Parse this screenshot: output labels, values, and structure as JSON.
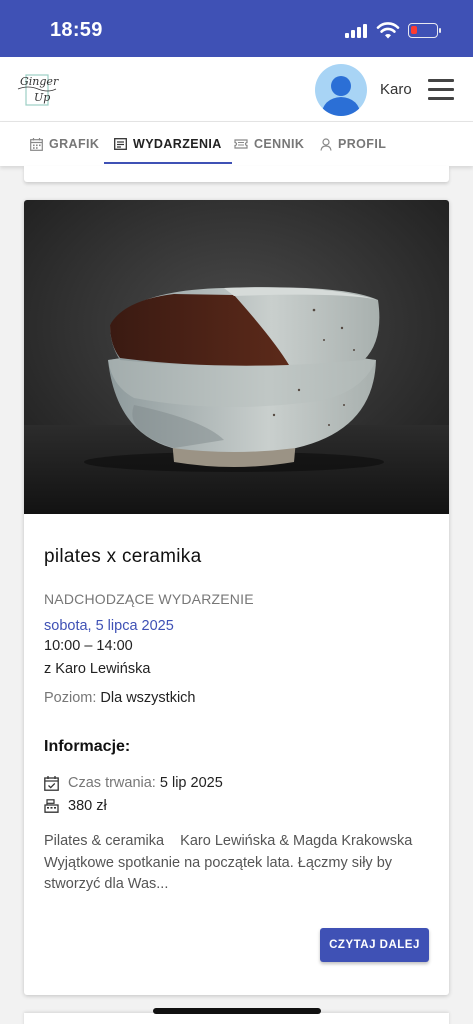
{
  "status_bar": {
    "time": "18:59"
  },
  "header": {
    "logo_line1": "Ginger",
    "logo_line2": "Up",
    "username": "Karo"
  },
  "tabs": [
    {
      "label": "GRAFIK",
      "icon": "calendar-icon",
      "active": false
    },
    {
      "label": "WYDARZENIA",
      "icon": "event-card-icon",
      "active": true
    },
    {
      "label": "CENNIK",
      "icon": "ticket-icon",
      "active": false
    },
    {
      "label": "PROFIL",
      "icon": "person-icon",
      "active": false
    }
  ],
  "event": {
    "title": "pilates x ceramika",
    "status": "NADCHODZĄCE WYDARZENIE",
    "date": "sobota, 5 lipca 2025",
    "time": "10:00 – 14:00",
    "host": "z Karo Lewińska",
    "level_label": "Poziom:",
    "level_value": "Dla wszystkich",
    "info_heading": "Informacje:",
    "duration_label": "Czas trwania:",
    "duration_value": "5 lip 2025",
    "price": "380 zł",
    "description": "Pilates & ceramika    Karo Lewińska & Magda Krakowska Wyjątkowe spotkanie na początek lata. Łączmy siły by stworzyć dla Was...",
    "read_more_label": "CZYTAJ DALEJ"
  },
  "colors": {
    "primary": "#3f51b5",
    "battery_low": "#ff3b30",
    "avatar_bg": "#a8d4f5"
  }
}
